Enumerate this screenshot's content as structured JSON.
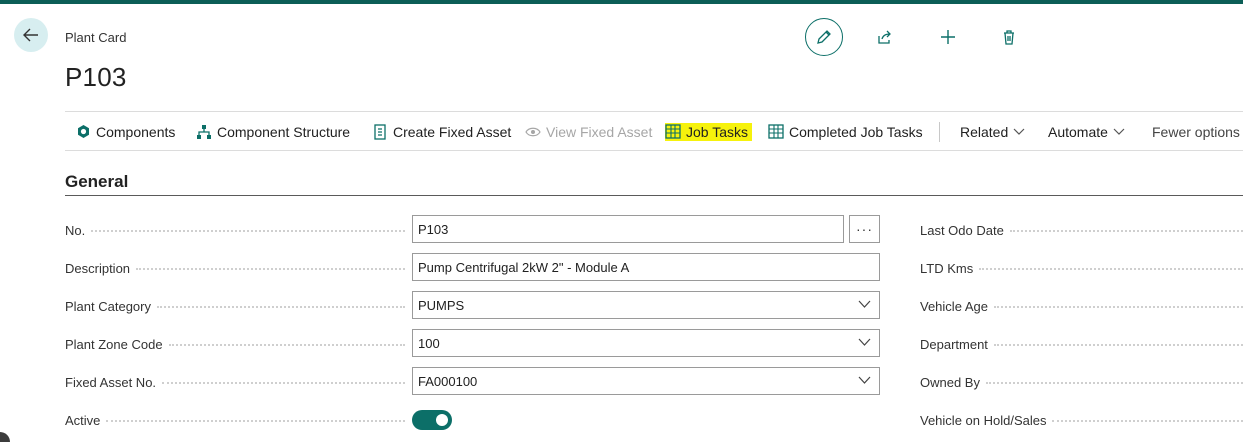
{
  "header": {
    "breadcrumb": "Plant Card",
    "title": "P103",
    "icons": [
      "back-arrow-icon",
      "pencil-icon",
      "share-icon",
      "plus-icon",
      "trash-icon"
    ]
  },
  "actions": [
    {
      "label": "Components",
      "icon": "hexagon-icon",
      "enabled": true
    },
    {
      "label": "Component Structure",
      "icon": "hierarchy-icon",
      "enabled": true
    },
    {
      "label": "Create Fixed Asset",
      "icon": "document-icon",
      "enabled": true
    },
    {
      "label": "View Fixed Asset",
      "icon": "eye-icon",
      "enabled": false
    },
    {
      "label": "Job Tasks",
      "icon": "task-grid-icon",
      "enabled": true,
      "highlighted": true
    },
    {
      "label": "Completed Job Tasks",
      "icon": "task-grid-icon",
      "enabled": true
    },
    {
      "label": "Related",
      "icon": "chevron-down-icon",
      "enabled": true
    },
    {
      "label": "Automate",
      "icon": "chevron-down-icon",
      "enabled": true
    },
    {
      "label": "Fewer options",
      "enabled": true
    }
  ],
  "section": {
    "title": "General"
  },
  "fields": [
    {
      "label": "No.",
      "value": "P103",
      "type": "text-with-assist"
    },
    {
      "label": "Description",
      "value": "Pump Centrifugal 2kW 2\" - Module A",
      "type": "text"
    },
    {
      "label": "Plant Category",
      "value": "PUMPS",
      "type": "select"
    },
    {
      "label": "Plant Zone Code",
      "value": "100",
      "type": "select"
    },
    {
      "label": "Fixed Asset No.",
      "value": "FA000100",
      "type": "select"
    },
    {
      "label": "Active",
      "value": "on",
      "type": "toggle"
    }
  ],
  "assist_button_label": "···",
  "right_fields": [
    {
      "label": "Last Odo Date"
    },
    {
      "label": "LTD Kms"
    },
    {
      "label": "Vehicle Age"
    },
    {
      "label": "Department"
    },
    {
      "label": "Owned By"
    },
    {
      "label": "Vehicle on Hold/Sales"
    }
  ],
  "colors": {
    "accent": "#0c6f68",
    "top_bar": "#0c5e57",
    "highlight": "#f6f20c",
    "back_button_bg": "#d7eef0"
  }
}
